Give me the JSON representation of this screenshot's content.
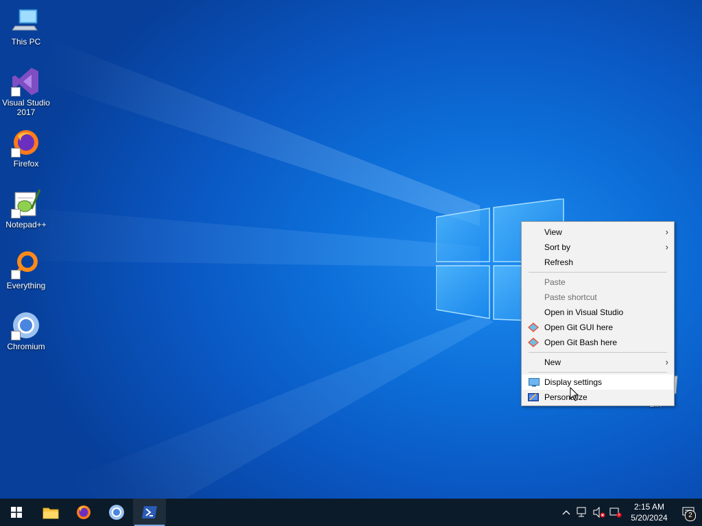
{
  "desktop": {
    "icons": [
      {
        "label": "This PC",
        "icon": "computer-icon"
      },
      {
        "label": "Visual Studio 2017",
        "icon": "visual-studio-icon"
      },
      {
        "label": "Firefox",
        "icon": "firefox-icon"
      },
      {
        "label": "Notepad++",
        "icon": "notepad-plus-plus-icon"
      },
      {
        "label": "Everything",
        "icon": "everything-icon"
      },
      {
        "label": "Chromium",
        "icon": "chromium-icon"
      }
    ],
    "recycle_bin_label": "Bin"
  },
  "context_menu": {
    "items": [
      {
        "label": "View",
        "submenu": true
      },
      {
        "label": "Sort by",
        "submenu": true
      },
      {
        "label": "Refresh"
      },
      {
        "label": "Paste",
        "disabled": true
      },
      {
        "label": "Paste shortcut",
        "disabled": true
      },
      {
        "label": "Open in Visual Studio"
      },
      {
        "label": "Open Git GUI here",
        "icon": "git-icon"
      },
      {
        "label": "Open Git Bash here",
        "icon": "git-icon"
      },
      {
        "label": "New",
        "submenu": true
      },
      {
        "label": "Display settings",
        "icon": "display-icon",
        "highlighted": true
      },
      {
        "label": "Personalize",
        "icon": "personalize-icon"
      }
    ],
    "submenu_arrow": "›"
  },
  "taskbar": {
    "pinned": [
      {
        "name": "start",
        "icon": "windows-start-icon"
      },
      {
        "name": "file-explorer",
        "icon": "folder-icon"
      },
      {
        "name": "firefox",
        "icon": "firefox-icon"
      },
      {
        "name": "chromium",
        "icon": "chromium-icon"
      },
      {
        "name": "powershell",
        "icon": "powershell-icon",
        "active": true
      }
    ],
    "tray": {
      "chevron": "^",
      "time": "2:15 AM",
      "date": "5/20/2024",
      "notification_count": "2"
    }
  },
  "colors": {
    "taskbar_bg": "#0c1b2a",
    "menu_bg": "#f2f2f2",
    "accent": "#0a57c2"
  }
}
